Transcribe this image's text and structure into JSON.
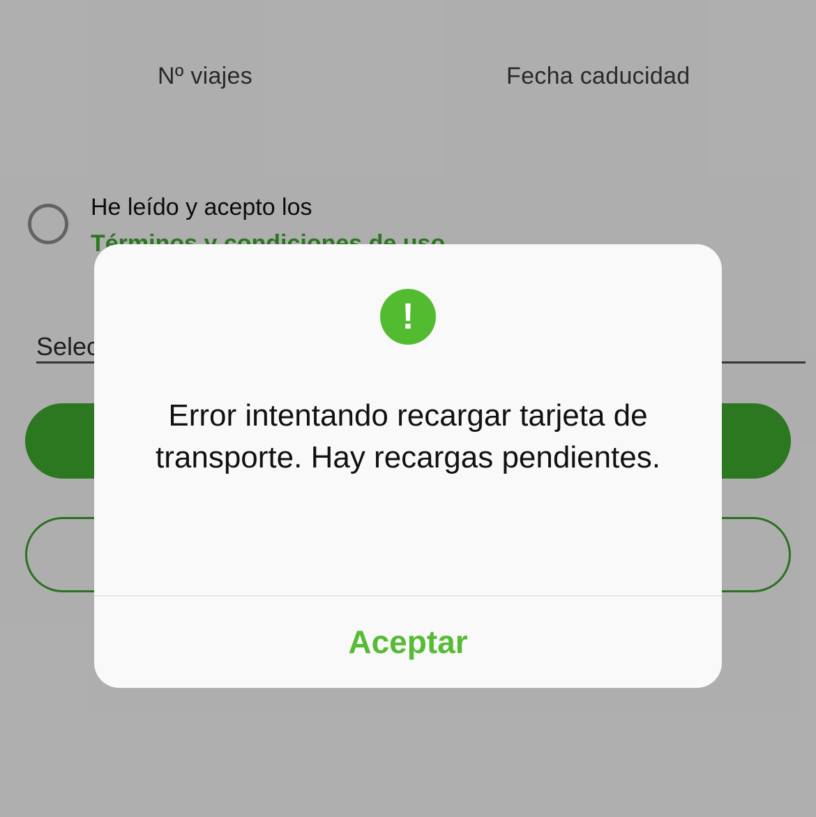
{
  "table_header": {
    "trips": "Nº viajes",
    "expiry_date": "Fecha caducidad"
  },
  "terms": {
    "text": "He leído y acepto los",
    "link": "Términos y condiciones de uso"
  },
  "select": {
    "label": "Selec"
  },
  "dialog": {
    "icon": "exclamation-icon",
    "icon_glyph": "!",
    "message": "Error intentando recargar tarjeta de transporte. Hay recargas pendientes.",
    "accept_label": "Aceptar"
  },
  "colors": {
    "accent_green": "#3ea72e",
    "dialog_button": "#57bb35"
  }
}
